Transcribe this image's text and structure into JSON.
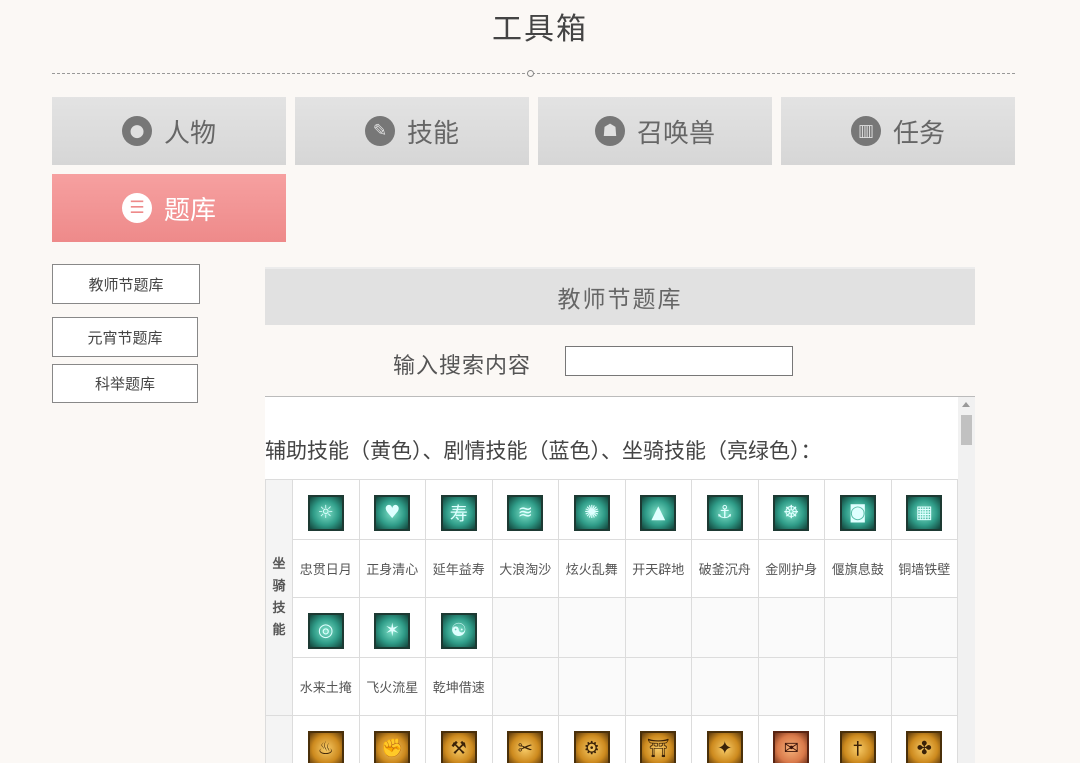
{
  "page": {
    "title": "工具箱"
  },
  "tabs": [
    {
      "label": "人物",
      "icon": "person-icon",
      "glyph": "●"
    },
    {
      "label": "技能",
      "icon": "quill-icon",
      "glyph": "✎"
    },
    {
      "label": "召唤兽",
      "icon": "beast-icon",
      "glyph": "☗"
    },
    {
      "label": "任务",
      "icon": "book-icon",
      "glyph": "▥"
    },
    {
      "label": "题库",
      "icon": "list-icon",
      "glyph": "☰",
      "active": true
    }
  ],
  "side_menu": [
    "教师节题库",
    "元宵节题库",
    "科举题库"
  ],
  "panel": {
    "header": "教师节题库",
    "search_label": "输入搜索内容",
    "search_value": ""
  },
  "content": {
    "section_title": "辅助技能（黄色）、剧情技能（蓝色）、坐骑技能（亮绿色）：",
    "category_label": [
      "坐",
      "骑",
      "技",
      "能"
    ],
    "mount_skills": [
      {
        "name": "忠贯日月",
        "icon": "sun-moon-icon",
        "glyph": "☼"
      },
      {
        "name": "正身清心",
        "icon": "heart-shield-icon",
        "glyph": "♥"
      },
      {
        "name": "延年益寿",
        "icon": "longevity-icon",
        "glyph": "寿"
      },
      {
        "name": "大浪淘沙",
        "icon": "wave-icon",
        "glyph": "≋"
      },
      {
        "name": "炫火乱舞",
        "icon": "flame-gear-icon",
        "glyph": "✺"
      },
      {
        "name": "开天辟地",
        "icon": "mountain-icon",
        "glyph": "▲"
      },
      {
        "name": "破釜沉舟",
        "icon": "boat-icon",
        "glyph": "⚓"
      },
      {
        "name": "金刚护身",
        "icon": "buddha-icon",
        "glyph": "☸"
      },
      {
        "name": "偃旗息鼓",
        "icon": "drum-icon",
        "glyph": "◙"
      },
      {
        "name": "铜墙铁壁",
        "icon": "wall-icon",
        "glyph": "▦"
      },
      {
        "name": "水来土掩",
        "icon": "water-swirl-icon",
        "glyph": "◎"
      },
      {
        "name": "飞火流星",
        "icon": "meteor-icon",
        "glyph": "✶"
      },
      {
        "name": "乾坤借速",
        "icon": "yin-yang-icon",
        "glyph": "☯"
      }
    ],
    "support_skills": [
      {
        "icon": "cooking-icon",
        "glyph": "♨",
        "color": "gold"
      },
      {
        "icon": "strength-icon",
        "glyph": "✊",
        "color": "gold"
      },
      {
        "icon": "crafting-icon",
        "glyph": "⚒",
        "color": "gold"
      },
      {
        "icon": "scissors-icon",
        "glyph": "✂",
        "color": "gold"
      },
      {
        "icon": "forging-icon",
        "glyph": "⚙",
        "color": "gold"
      },
      {
        "icon": "gate-icon",
        "glyph": "⛩",
        "color": "gold"
      },
      {
        "icon": "runner-icon",
        "glyph": "✦",
        "color": "gold"
      },
      {
        "icon": "scroll-icon",
        "glyph": "✉",
        "color": "red"
      },
      {
        "icon": "dagger-icon",
        "glyph": "†",
        "color": "gold"
      },
      {
        "icon": "boot-icon",
        "glyph": "✤",
        "color": "gold"
      }
    ]
  }
}
